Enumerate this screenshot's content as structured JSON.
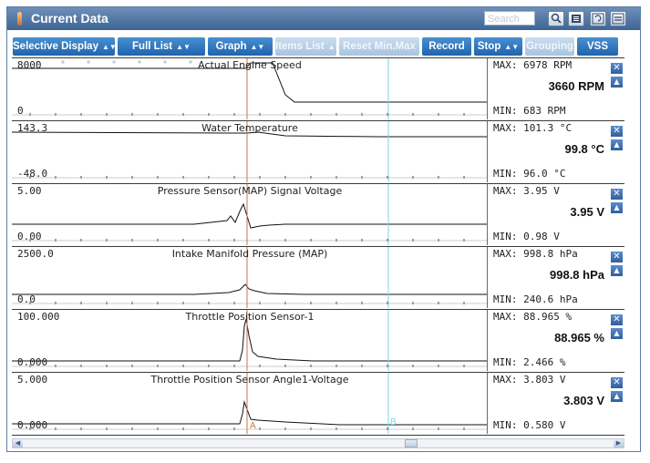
{
  "title": "Current Data",
  "search_placeholder": "Search",
  "toolbar": {
    "selective_display": "Selective Display",
    "full_list": "Full List",
    "graph": "Graph",
    "items_list": "Items List",
    "reset_min_max": "Reset Min.Max",
    "record": "Record",
    "stop": "Stop",
    "grouping": "Grouping",
    "vss": "VSS"
  },
  "icons": {
    "app": "warning-bulb-icon",
    "find": "find-icon",
    "list": "list-view-icon",
    "retry": "retry-icon",
    "menu": "menu-icon"
  },
  "cursor_labels": {
    "a": "A",
    "b": "B"
  },
  "colors": {
    "title_bar": "#3d6596",
    "button": "#1f64ad",
    "cursor_a": "#c9763c",
    "cursor_b": "#7ed4e6",
    "trace": "#111111"
  },
  "parameters": [
    {
      "name": "Actual Engine Speed",
      "y_max": "8000",
      "y_min": "0",
      "max": "MAX:  6978 RPM",
      "current": "3660 RPM",
      "min": "MIN:  683 RPM"
    },
    {
      "name": "Water Temperature",
      "y_max": "143.3",
      "y_min": "-48.0",
      "max": "MAX: 101.3 °C",
      "current": "99.8 °C",
      "min": "MIN: 96.0 °C"
    },
    {
      "name": "Pressure Sensor(MAP) Signal Voltage",
      "y_max": "5.00",
      "y_min": "0.00",
      "max": "MAX:  3.95 V",
      "current": "3.95 V",
      "min": "MIN: 0.98 V"
    },
    {
      "name": "Intake Manifold Pressure (MAP)",
      "y_max": "2500.0",
      "y_min": "0.0",
      "max": "MAX: 998.8 hPa",
      "current": "998.8 hPa",
      "min": "MIN: 240.6 hPa"
    },
    {
      "name": "Throttle Position Sensor-1",
      "y_max": "100.000",
      "y_min": "0.000",
      "max": "MAX: 88.965 %",
      "current": "88.965 %",
      "min": "MIN: 2.466 %"
    },
    {
      "name": "Throttle Position Sensor Angle1-Voltage",
      "y_max": "5.000",
      "y_min": "0.000",
      "max": "MAX: 3.803 V",
      "current": "3.803 V",
      "min": "MIN: 0.580 V"
    }
  ]
}
